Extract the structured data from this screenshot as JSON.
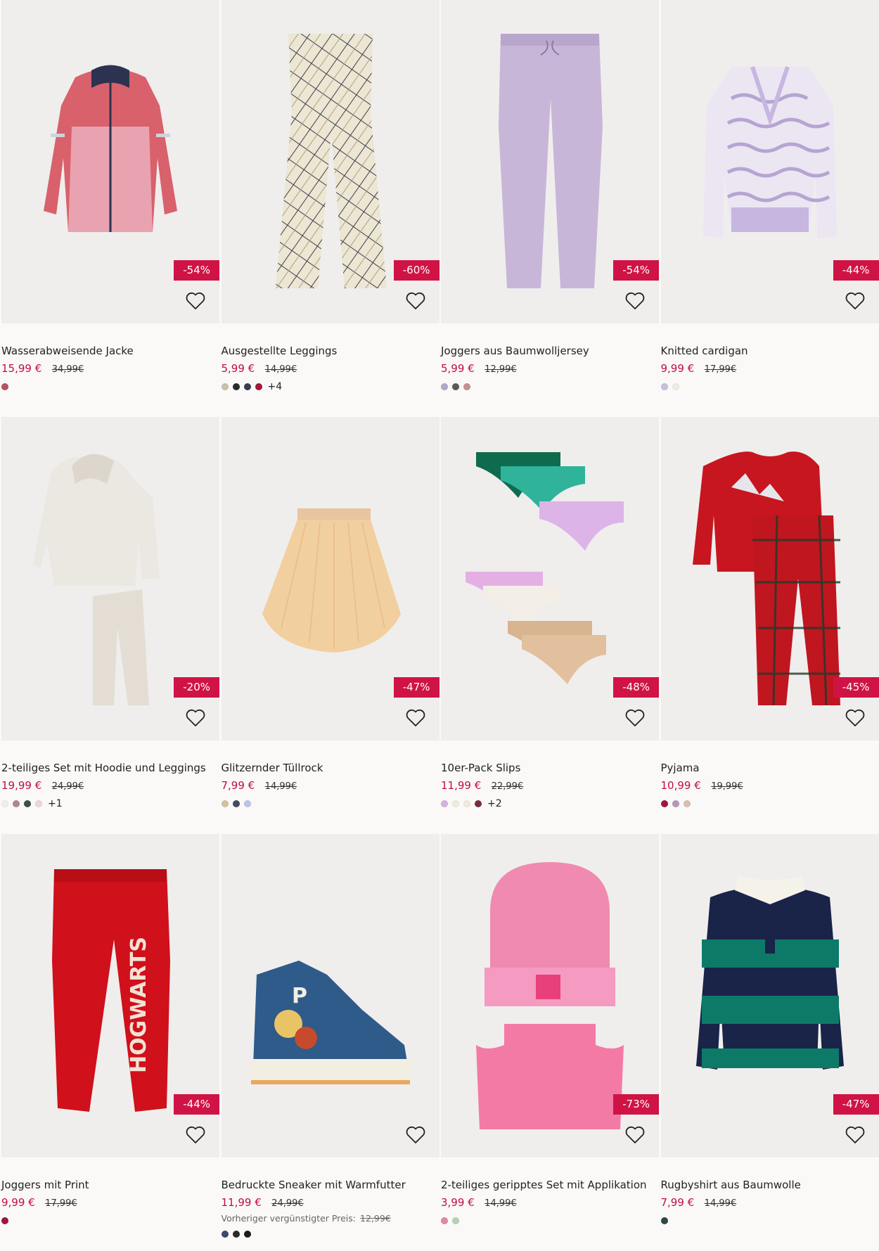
{
  "products": [
    {
      "name": "Wasserabweisende Jacke",
      "price": "15,99 €",
      "old_price": "34,99€",
      "discount": "-54%",
      "art": "jacket",
      "swatches": [
        "#b85060"
      ],
      "more": ""
    },
    {
      "name": "Ausgestellte Leggings",
      "price": "5,99 €",
      "old_price": "14,99€",
      "discount": "-60%",
      "art": "plaid",
      "swatches": [
        "#c9c0a8",
        "#2a2a2a",
        "#3a3d50",
        "#a3153a"
      ],
      "more": "+4"
    },
    {
      "name": "Joggers aus Baumwolljersey",
      "price": "5,99 €",
      "old_price": "12,99€",
      "discount": "-54%",
      "art": "joggers-lilac",
      "swatches": [
        "#b6a6c8",
        "#5a5a5a",
        "#c98f93"
      ],
      "more": ""
    },
    {
      "name": "Knitted cardigan",
      "price": "9,99 €",
      "old_price": "17,99€",
      "discount": "-44%",
      "art": "cardigan",
      "swatches": [
        "#c8c0de",
        "#f0ece2"
      ],
      "more": ""
    },
    {
      "name": "2-teiliges Set mit Hoodie und Leggings",
      "price": "19,99 €",
      "old_price": "24,99€",
      "discount": "-20%",
      "art": "hoodie-set",
      "swatches": [
        "#f2eee6",
        "#b08890",
        "#3b5048",
        "#e9d8dc"
      ],
      "more": "+1"
    },
    {
      "name": "Glitzernder Tüllrock",
      "price": "7,99 €",
      "old_price": "14,99€",
      "discount": "-47%",
      "art": "skirt",
      "swatches": [
        "#d6c0a0",
        "#454a5e",
        "#b9c6e6"
      ],
      "more": ""
    },
    {
      "name": "10er-Pack Slips",
      "price": "11,99 €",
      "old_price": "22,99€",
      "discount": "-48%",
      "art": "slips",
      "swatches": [
        "#d6b0e0",
        "#f0ece2",
        "#f4eadc",
        "#7a2c3c"
      ],
      "more": "+2"
    },
    {
      "name": "Pyjama",
      "price": "10,99 €",
      "old_price": "19,99€",
      "discount": "-45%",
      "art": "pyjama",
      "swatches": [
        "#a3153a",
        "#b49ab8",
        "#d8c0b0"
      ],
      "more": ""
    },
    {
      "name": "Joggers mit Print",
      "price": "9,99 €",
      "old_price": "17,99€",
      "discount": "-44%",
      "art": "joggers-red",
      "swatches": [
        "#a3153a"
      ],
      "more": ""
    },
    {
      "name": "Bedruckte Sneaker mit Warmfutter",
      "price": "11,99 €",
      "old_price": "24,99€",
      "discount": "",
      "art": "sneaker",
      "prev_label": "Vorheriger vergünstigter Preis:",
      "prev_value": "12,99€",
      "swatches": [
        "#3b4a66",
        "#2a2a2a",
        "#1c1c1c"
      ],
      "more": ""
    },
    {
      "name": "2-teiliges geripptes Set mit Applikation",
      "price": "3,99 €",
      "old_price": "14,99€",
      "discount": "-73%",
      "art": "beanie",
      "swatches": [
        "#e08aa8",
        "#b8d0b8"
      ],
      "more": ""
    },
    {
      "name": "Rugbyshirt aus Baumwolle",
      "price": "7,99 €",
      "old_price": "14,99€",
      "discount": "-47%",
      "art": "rugby",
      "swatches": [
        "#2d4a46"
      ],
      "more": ""
    }
  ],
  "colors": {
    "sale": "#c20d3e",
    "badge": "#d01345"
  }
}
